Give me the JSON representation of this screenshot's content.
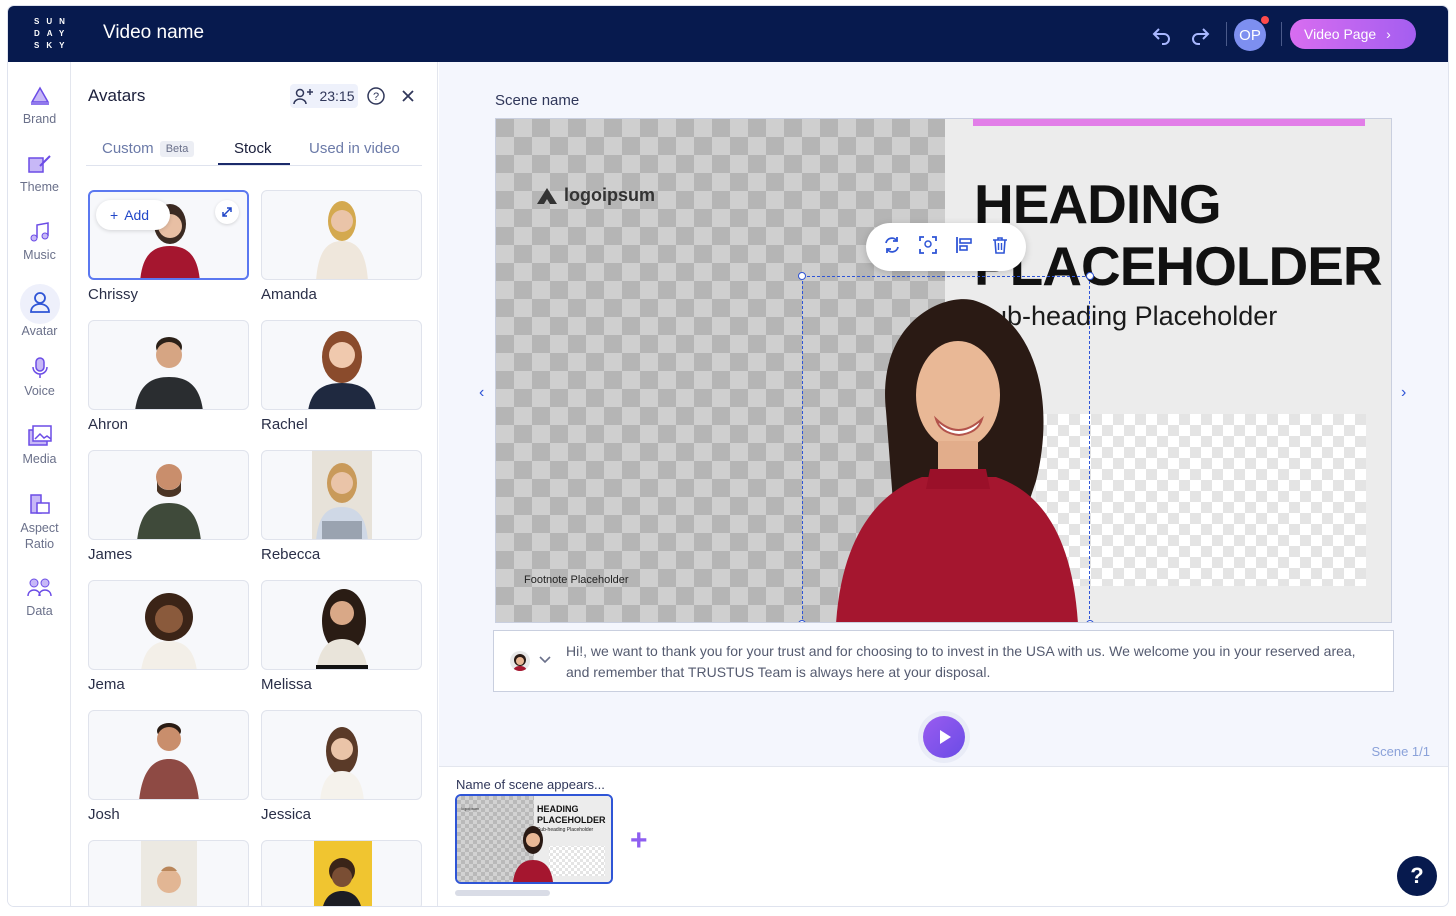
{
  "app": {
    "logo_text": "SUNDAYSKY",
    "video_name": "Video name",
    "user_initials": "OP",
    "video_page_label": "Video Page"
  },
  "rail": {
    "items": [
      {
        "label": "Brand",
        "icon": "brand-icon"
      },
      {
        "label": "Theme",
        "icon": "theme-icon"
      },
      {
        "label": "Music",
        "icon": "music-icon"
      },
      {
        "label": "Avatar",
        "icon": "avatar-icon"
      },
      {
        "label": "Voice",
        "icon": "microphone-icon"
      },
      {
        "label": "Media",
        "icon": "media-icon"
      },
      {
        "label": "Aspect\nRatio",
        "icon": "aspect-ratio-icon"
      },
      {
        "label": "Data",
        "icon": "data-icon"
      }
    ]
  },
  "panel": {
    "title": "Avatars",
    "credits": "23:15",
    "tabs": [
      {
        "label": "Custom",
        "badge": "Beta"
      },
      {
        "label": "Stock"
      },
      {
        "label": "Used in video"
      }
    ],
    "add_label": "Add",
    "avatars": [
      "Chrissy",
      "Amanda",
      "Ahron",
      "Rachel",
      "James",
      "Rebecca",
      "Jema",
      "Melissa",
      "Josh",
      "Jessica"
    ]
  },
  "stage": {
    "scene_name": "Scene name",
    "logo": "logoipsum",
    "heading": "HEADING PLACEHOLDER",
    "subheading": "Sub-heading Placeholder",
    "footnote": "Footnote Placeholder"
  },
  "script": {
    "text": "Hi!, we want to thank you for your trust and for choosing to to invest in the USA with us. We welcome you in your reserved area, and remember that TRUSTUS Team is always here at your disposal."
  },
  "timeline": {
    "scene_count": "Scene 1/1",
    "scene_label": "Name of scene appears..."
  },
  "colors": {
    "topbar": "#071a4e",
    "accent": "#2f55d6",
    "cta_gradient_start": "#d86df0",
    "cta_gradient_end": "#a45ef0"
  }
}
